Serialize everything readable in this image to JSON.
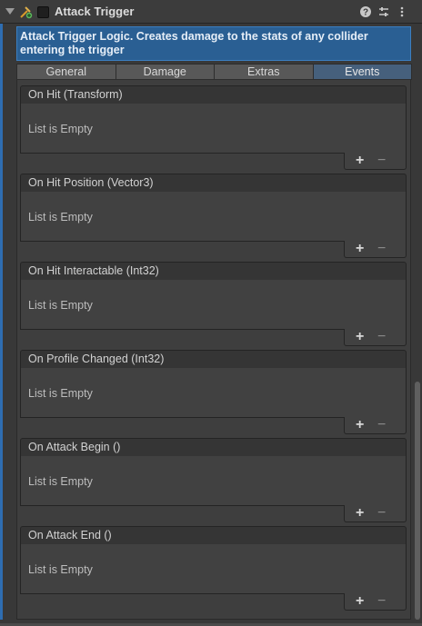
{
  "component": {
    "title": "Attack Trigger",
    "description": "Attack Trigger Logic. Creates damage to the stats of any collider entering the trigger",
    "header_icons": [
      "help-icon",
      "presets-icon",
      "more-icon"
    ]
  },
  "tabs": [
    {
      "label": "General",
      "active": false
    },
    {
      "label": "Damage",
      "active": false
    },
    {
      "label": "Extras",
      "active": false
    },
    {
      "label": "Events",
      "active": true
    }
  ],
  "events": [
    {
      "title": "On Hit (Transform)",
      "empty_text": "List is Empty"
    },
    {
      "title": "On Hit Position (Vector3)",
      "empty_text": "List is Empty"
    },
    {
      "title": "On Hit Interactable (Int32)",
      "empty_text": "List is Empty"
    },
    {
      "title": "On Profile Changed (Int32)",
      "empty_text": "List is Empty"
    },
    {
      "title": "On Attack Begin ()",
      "empty_text": "List is Empty"
    },
    {
      "title": "On Attack End ()",
      "empty_text": "List is Empty"
    }
  ],
  "list_controls": {
    "add": "+",
    "remove": "−"
  },
  "colors": {
    "accent": "#2e6db1",
    "description_bg": "#2a5f93",
    "active_tab": "#46607c"
  }
}
